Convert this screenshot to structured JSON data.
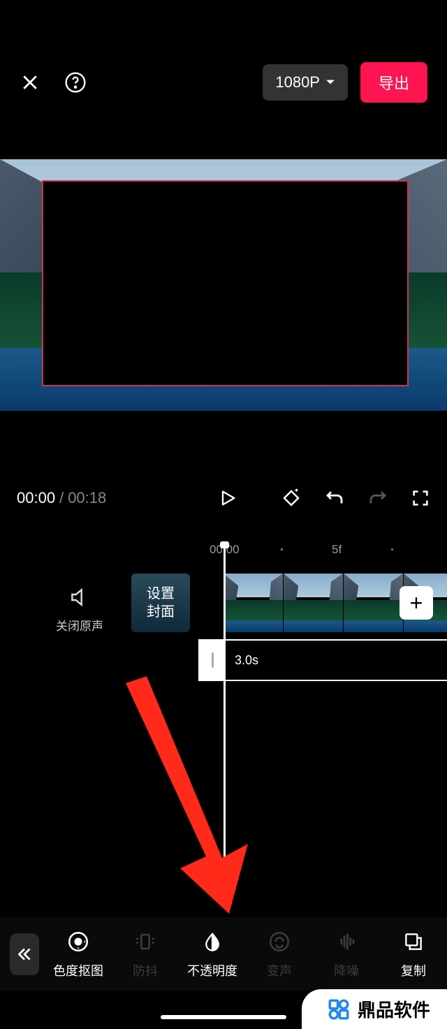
{
  "header": {
    "resolution": "1080P",
    "export": "导出"
  },
  "playback": {
    "current": "00:00",
    "total": "00:18"
  },
  "ruler": {
    "t0": "00:00",
    "t1": "5f"
  },
  "timeline": {
    "mute_label": "关闭原声",
    "cover_label": "设置\n封面",
    "overlay_duration": "3.0s"
  },
  "tools": [
    {
      "key": "chroma",
      "label": "色度抠图",
      "active": true
    },
    {
      "key": "stabilize",
      "label": "防抖",
      "active": false
    },
    {
      "key": "opacity",
      "label": "不透明度",
      "active": true
    },
    {
      "key": "voicechange",
      "label": "变声",
      "active": false
    },
    {
      "key": "denoise",
      "label": "降噪",
      "active": false
    },
    {
      "key": "copy",
      "label": "复制",
      "active": true
    }
  ],
  "watermark": "鼎品软件"
}
